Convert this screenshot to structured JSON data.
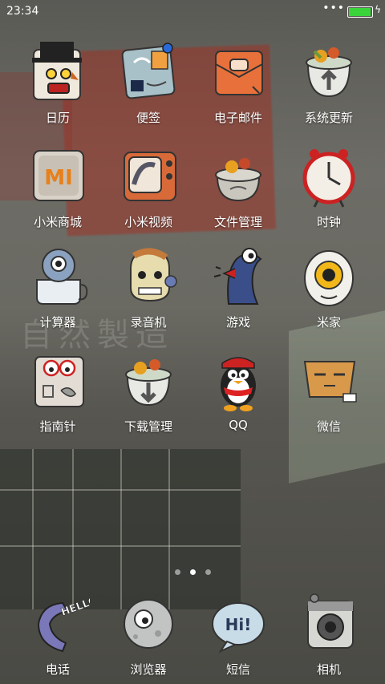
{
  "status": {
    "time": "23:34",
    "signal": "•••",
    "battery_level": 0.95,
    "charge": "ϟ"
  },
  "wallpaper": {
    "text": "自然製造"
  },
  "grid": [
    {
      "label": "日历",
      "icon": "calendar-icon"
    },
    {
      "label": "便签",
      "icon": "notes-icon"
    },
    {
      "label": "电子邮件",
      "icon": "email-icon"
    },
    {
      "label": "系统更新",
      "icon": "system-update-icon"
    },
    {
      "label": "小米商城",
      "icon": "mi-store-icon"
    },
    {
      "label": "小米视频",
      "icon": "mi-video-icon"
    },
    {
      "label": "文件管理",
      "icon": "file-manager-icon"
    },
    {
      "label": "时钟",
      "icon": "clock-icon"
    },
    {
      "label": "计算器",
      "icon": "calculator-icon"
    },
    {
      "label": "录音机",
      "icon": "recorder-icon"
    },
    {
      "label": "游戏",
      "icon": "game-icon"
    },
    {
      "label": "米家",
      "icon": "mijia-icon"
    },
    {
      "label": "指南针",
      "icon": "compass-icon"
    },
    {
      "label": "下载管理",
      "icon": "download-manager-icon"
    },
    {
      "label": "QQ",
      "icon": "qq-icon"
    },
    {
      "label": "微信",
      "icon": "wechat-icon"
    }
  ],
  "dock": [
    {
      "label": "电话",
      "icon": "phone-icon",
      "glyph": "HELLO"
    },
    {
      "label": "浏览器",
      "icon": "browser-icon"
    },
    {
      "label": "短信",
      "icon": "sms-icon",
      "glyph": "Hi!"
    },
    {
      "label": "相机",
      "icon": "camera-icon"
    }
  ],
  "mi_logo": "MI",
  "pager": {
    "pages": 3,
    "active": 1
  },
  "colors": {
    "battery": "#3ad43a",
    "wallpaper_red": "#aa2819"
  }
}
